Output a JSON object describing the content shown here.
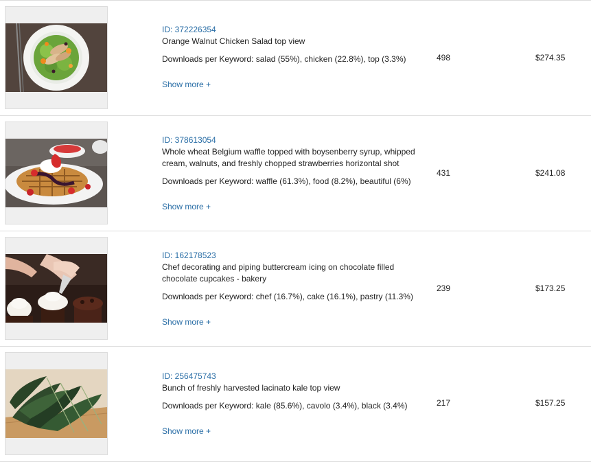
{
  "items": [
    {
      "id": "ID: 372226354",
      "title": "Orange Walnut Chicken Salad top view",
      "downloads_per_keyword": "Downloads per Keyword: salad (55%), chicken (22.8%), top (3.3%)",
      "show_more": "Show more +",
      "downloads": "498",
      "earnings": "$274.35"
    },
    {
      "id": "ID: 378613054",
      "title": "Whole wheat Belgium waffle topped with boysenberry syrup, whipped cream, walnuts, and freshly chopped strawberries horizontal shot",
      "downloads_per_keyword": "Downloads per Keyword: waffle (61.3%), food (8.2%), beautiful (6%)",
      "show_more": "Show more +",
      "downloads": "431",
      "earnings": "$241.08"
    },
    {
      "id": "ID: 162178523",
      "title": "Chef decorating and piping buttercream icing on chocolate filled chocolate cupcakes - bakery",
      "downloads_per_keyword": "Downloads per Keyword: chef (16.7%), cake (16.1%), pastry (11.3%)",
      "show_more": "Show more +",
      "downloads": "239",
      "earnings": "$173.25"
    },
    {
      "id": "ID: 256475743",
      "title": "Bunch of freshly harvested lacinato kale top view",
      "downloads_per_keyword": "Downloads per Keyword: kale (85.6%), cavolo (3.4%), black (3.4%)",
      "show_more": "Show more +",
      "downloads": "217",
      "earnings": "$157.25"
    }
  ]
}
